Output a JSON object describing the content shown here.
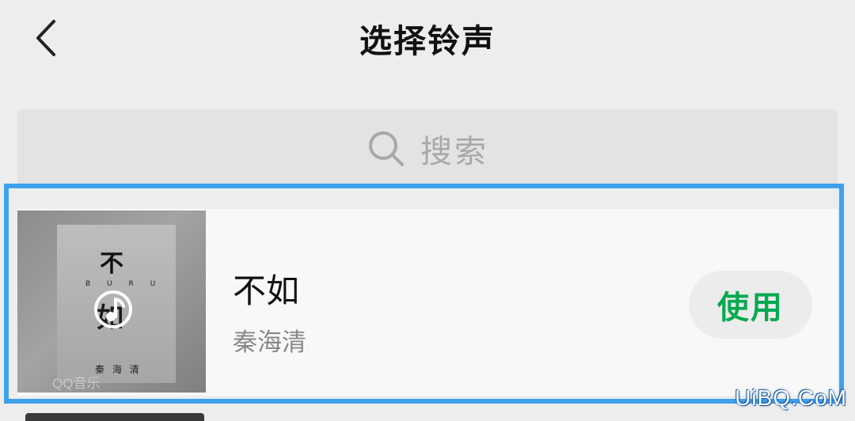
{
  "header": {
    "back_icon": "chevron-left-icon",
    "title": "选择铃声"
  },
  "search": {
    "icon": "search-icon",
    "placeholder": "搜索"
  },
  "ringtone_list": [
    {
      "title": "不如",
      "artist": "秦海清",
      "action_label": "使用",
      "selected": true,
      "cover": {
        "title_text": "不",
        "subtitle_text": "B U R U",
        "ghost_text": "如",
        "artist_text": "秦 海 清",
        "brand_text": "QQ音乐",
        "overlay_icon": "music-note-icon"
      }
    }
  ],
  "colors": {
    "background": "#ededed",
    "search_bg": "#e3e3e3",
    "card_bg": "#f8f8f8",
    "action_text": "#07a951",
    "highlight_border": "#3ea1ec"
  },
  "watermark": "UiBQ.CoM"
}
